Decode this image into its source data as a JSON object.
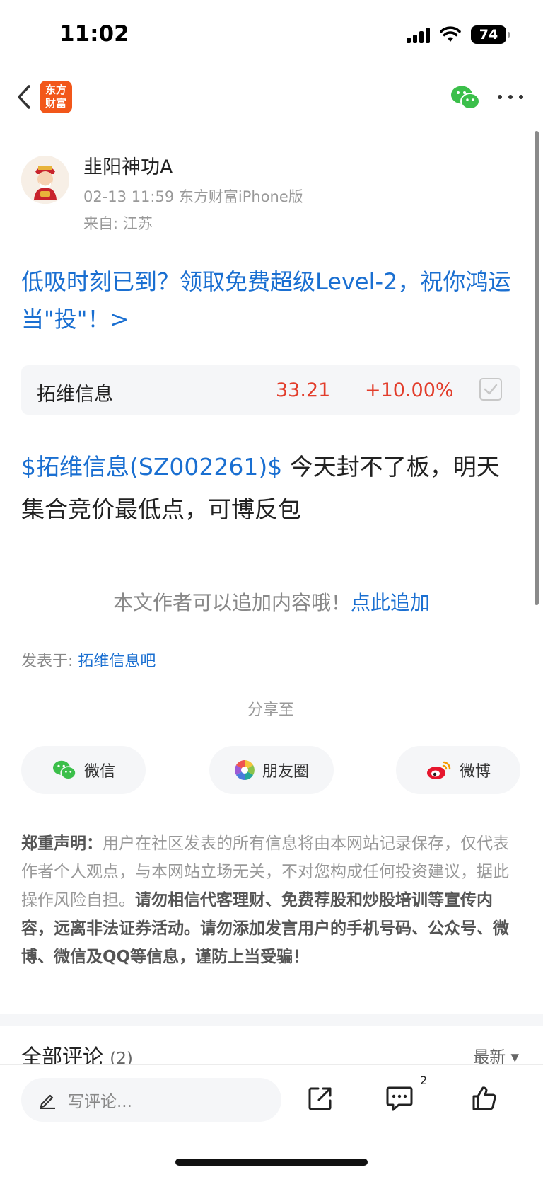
{
  "status_bar": {
    "time": "11:02",
    "battery": "74"
  },
  "nav": {
    "logo_line1": "东方",
    "logo_line2": "财富"
  },
  "author": {
    "name": "韭阳神功A",
    "meta": "02-13 11:59 东方财富iPhone版",
    "location": "来自: 江苏"
  },
  "promo": {
    "text": "低吸时刻已到？领取免费超级Level-2，祝你鸿运当\"投\"！>"
  },
  "stock_card": {
    "name": "拓维信息",
    "price": "33.21",
    "change": "+10.00%"
  },
  "post": {
    "stock_tag": "$拓维信息(SZ002261)$",
    "text": " 今天封不了板，明天集合竞价最低点，可博反包"
  },
  "append": {
    "hint": "本文作者可以追加内容哦！",
    "link": "点此追加"
  },
  "posted_in": {
    "label": "发表于: ",
    "forum": "拓维信息吧"
  },
  "share": {
    "label": "分享至",
    "wechat": "微信",
    "moments": "朋友圈",
    "weibo": "微博"
  },
  "disclaimer": {
    "heading": "郑重声明：",
    "body": "用户在社区发表的所有信息将由本网站记录保存，仅代表作者个人观点，与本网站立场无关，不对您构成任何投资建议，据此操作风险自担。",
    "warning": "请勿相信代客理财、免费荐股和炒股培训等宣传内容，远离非法证券活动。请勿添加发言用户的手机号码、公众号、微博、微信及QQ等信息，谨防上当受骗！"
  },
  "comments": {
    "title": "全部评论",
    "count": "(2)",
    "sort": "最新 ▾"
  },
  "bottom_bar": {
    "input_placeholder": "写评论...",
    "comment_badge": "2"
  },
  "colors": {
    "link_blue": "#1a6fd1",
    "rise_red": "#e23d2b",
    "brand_orange": "#f2571a",
    "wechat_green": "#3bbf4a"
  }
}
